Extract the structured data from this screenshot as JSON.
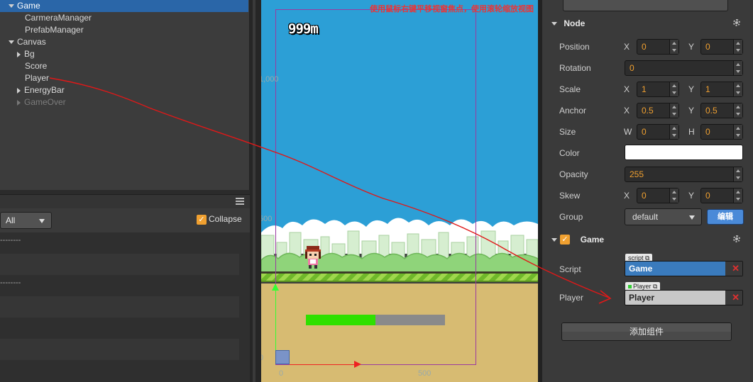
{
  "hierarchy": {
    "items": [
      {
        "label": "Game",
        "indent": 0,
        "expand": "down",
        "selected": true,
        "dim": false
      },
      {
        "label": "CarmeraManager",
        "indent": 1,
        "expand": "none",
        "selected": false,
        "dim": false
      },
      {
        "label": "PrefabManager",
        "indent": 1,
        "expand": "none",
        "selected": false,
        "dim": false
      },
      {
        "label": "Canvas",
        "indent": 0,
        "expand": "down",
        "selected": false,
        "dim": false
      },
      {
        "label": "Bg",
        "indent": 1,
        "expand": "right",
        "selected": false,
        "dim": false
      },
      {
        "label": "Score",
        "indent": 1,
        "expand": "none",
        "selected": false,
        "dim": false
      },
      {
        "label": "Player",
        "indent": 1,
        "expand": "none",
        "selected": false,
        "dim": false
      },
      {
        "label": "EnergyBar",
        "indent": 1,
        "expand": "right",
        "selected": false,
        "dim": false
      },
      {
        "label": "GameOver",
        "indent": 1,
        "expand": "right",
        "selected": false,
        "dim": true
      }
    ]
  },
  "console": {
    "filter_value": "All",
    "collapse_label": "Collapse",
    "collapse_checked": true,
    "rows": [
      {
        "text": "--------",
        "alt": false
      },
      {
        "text": "",
        "alt": true
      },
      {
        "text": "--------",
        "alt": false
      },
      {
        "text": "",
        "alt": true
      },
      {
        "text": "",
        "alt": false
      },
      {
        "text": "",
        "alt": true
      }
    ]
  },
  "scene": {
    "hint": "使用鼠标右键平移视窗焦点，使用滚轮缩放视图",
    "score": "999m",
    "ruler_y_1000": "1,000",
    "ruler_y_500": "500",
    "ruler_y_0": "0",
    "ruler_x_0": "0",
    "ruler_x_500": "500",
    "energy_fraction": 0.5,
    "colors": {
      "sky": "#2c9fd6",
      "grass": "#9fd84c",
      "dirt": "#d7bb72",
      "energy": "#2fe000"
    }
  },
  "inspector": {
    "node_title": "Node",
    "labels": {
      "position": "Position",
      "rotation": "Rotation",
      "scale": "Scale",
      "anchor": "Anchor",
      "size": "Size",
      "color": "Color",
      "opacity": "Opacity",
      "skew": "Skew",
      "group": "Group"
    },
    "axes": {
      "x": "X",
      "y": "Y",
      "w": "W",
      "h": "H"
    },
    "values": {
      "position_x": "0",
      "position_y": "0",
      "rotation": "0",
      "scale_x": "1",
      "scale_y": "1",
      "anchor_x": "0.5",
      "anchor_y": "0.5",
      "size_w": "0",
      "size_h": "0",
      "opacity": "255",
      "skew_x": "0",
      "skew_y": "0",
      "group": "default"
    },
    "color_value": "#ffffff",
    "edit_button": "编辑",
    "component_title": "Game",
    "component_enabled": true,
    "script_label": "Script",
    "script_tag": "script",
    "script_value": "Game",
    "player_label": "Player",
    "player_tag": "Player",
    "player_value": "Player",
    "add_component": "添加组件"
  }
}
